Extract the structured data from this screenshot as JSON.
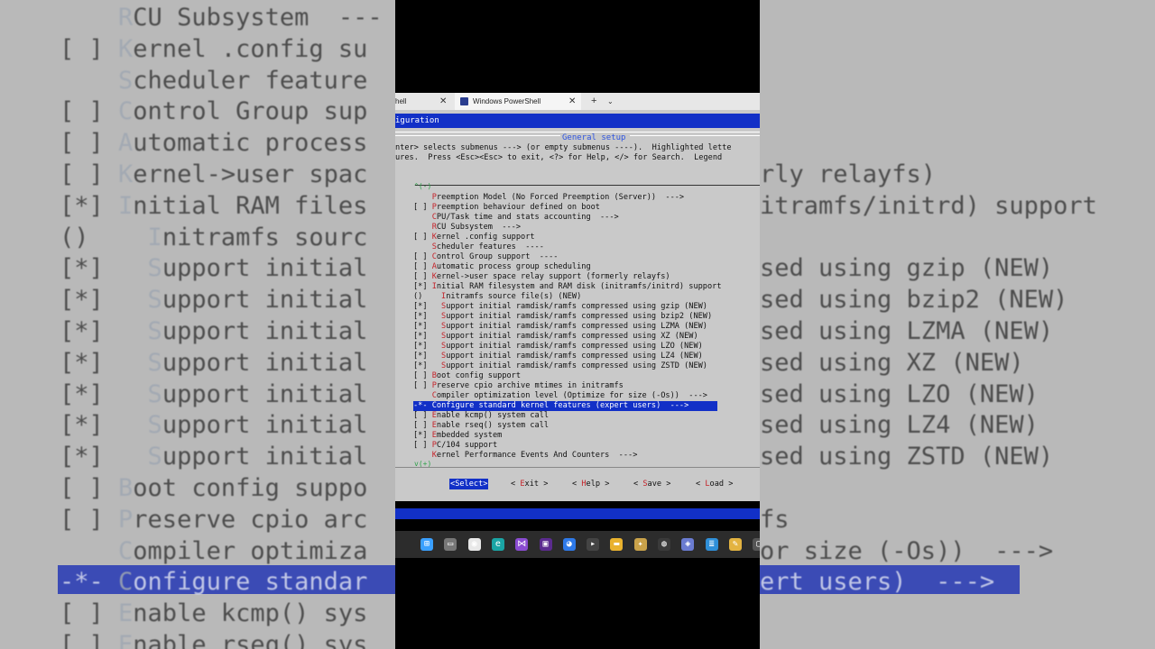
{
  "background": {
    "lines": [
      {
        "prefix": "    ",
        "hotkey": "R",
        "rest": "CU Subsystem  ---",
        "right": ""
      },
      {
        "prefix": "[ ] ",
        "hotkey": "K",
        "rest": "ernel .config su",
        "right": ""
      },
      {
        "prefix": "    ",
        "hotkey": "S",
        "rest": "cheduler feature",
        "right": ""
      },
      {
        "prefix": "[ ] ",
        "hotkey": "C",
        "rest": "ontrol Group sup",
        "right": ""
      },
      {
        "prefix": "[ ] ",
        "hotkey": "A",
        "rest": "utomatic process",
        "right": ""
      },
      {
        "prefix": "[ ] ",
        "hotkey": "K",
        "rest": "ernel->user spac",
        "right": "rly relayfs)"
      },
      {
        "prefix": "[*] ",
        "hotkey": "I",
        "rest": "nitial RAM files",
        "right": "itramfs/initrd) support"
      },
      {
        "prefix": "()    ",
        "hotkey": "I",
        "rest": "nitramfs sourc",
        "right": ""
      },
      {
        "prefix": "[*]   ",
        "hotkey": "S",
        "rest": "upport initial",
        "right": "sed using gzip (NEW)"
      },
      {
        "prefix": "[*]   ",
        "hotkey": "S",
        "rest": "upport initial",
        "right": "sed using bzip2 (NEW)"
      },
      {
        "prefix": "[*]   ",
        "hotkey": "S",
        "rest": "upport initial",
        "right": "sed using LZMA (NEW)"
      },
      {
        "prefix": "[*]   ",
        "hotkey": "S",
        "rest": "upport initial",
        "right": "sed using XZ (NEW)"
      },
      {
        "prefix": "[*]   ",
        "hotkey": "S",
        "rest": "upport initial",
        "right": "sed using LZO (NEW)"
      },
      {
        "prefix": "[*]   ",
        "hotkey": "S",
        "rest": "upport initial",
        "right": "sed using LZ4 (NEW)"
      },
      {
        "prefix": "[*]   ",
        "hotkey": "S",
        "rest": "upport initial",
        "right": "sed using ZSTD (NEW)"
      },
      {
        "prefix": "[ ] ",
        "hotkey": "B",
        "rest": "oot config suppo",
        "right": ""
      },
      {
        "prefix": "[ ] ",
        "hotkey": "P",
        "rest": "reserve cpio arc",
        "right": "fs"
      },
      {
        "prefix": "    ",
        "hotkey": "C",
        "rest": "ompiler optimiza",
        "right": "or size (-Os))  --->"
      },
      {
        "prefix": "-*- ",
        "hotkey": "C",
        "rest": "onfigure standar",
        "right": "ert users)  --->"
      },
      {
        "prefix": "[ ] ",
        "hotkey": "E",
        "rest": "nable kcmp() sys",
        "right": ""
      },
      {
        "prefix": "[ ] ",
        "hotkey": "E",
        "rest": "nable rseq() sys",
        "right": ""
      }
    ]
  },
  "tabs": {
    "tab1_label": "hell",
    "tab2_label": "Windows PowerShell",
    "close": "✕",
    "new_tab": "+",
    "dropdown": "⌄"
  },
  "terminal": {
    "title": "iguration",
    "panel_title": "General setup",
    "help_line1": "nter> selects submenus ---> (or empty submenus ----).  Highlighted lette",
    "help_line2": "ures.  Press <Esc><Esc> to exit, <?> for Help, </> for Search.  Legend",
    "scroll_up": "^(-)",
    "scroll_down": "v(+)",
    "menu": [
      {
        "prefix": "    ",
        "hotkey": "P",
        "rest": "reemption Model (No Forced Preemption (Server))  --->",
        "selected": false
      },
      {
        "prefix": "[ ] ",
        "hotkey": "P",
        "rest": "reemption behaviour defined on boot",
        "selected": false
      },
      {
        "prefix": "    ",
        "hotkey": "C",
        "rest": "PU/Task time and stats accounting  --->",
        "selected": false
      },
      {
        "prefix": "    ",
        "hotkey": "R",
        "rest": "CU Subsystem  --->",
        "selected": false
      },
      {
        "prefix": "[ ] ",
        "hotkey": "K",
        "rest": "ernel .config support",
        "selected": false
      },
      {
        "prefix": "    ",
        "hotkey": "S",
        "rest": "cheduler features  ----",
        "selected": false
      },
      {
        "prefix": "[ ] ",
        "hotkey": "C",
        "rest": "ontrol Group support  ----",
        "selected": false
      },
      {
        "prefix": "[ ] ",
        "hotkey": "A",
        "rest": "utomatic process group scheduling",
        "selected": false
      },
      {
        "prefix": "[ ] ",
        "hotkey": "K",
        "rest": "ernel->user space relay support (formerly relayfs)",
        "selected": false
      },
      {
        "prefix": "[*] ",
        "hotkey": "I",
        "rest": "nitial RAM filesystem and RAM disk (initramfs/initrd) support",
        "selected": false
      },
      {
        "prefix": "()    ",
        "hotkey": "I",
        "rest": "nitramfs source file(s) (NEW)",
        "selected": false
      },
      {
        "prefix": "[*]   ",
        "hotkey": "S",
        "rest": "upport initial ramdisk/ramfs compressed using gzip (NEW)",
        "selected": false
      },
      {
        "prefix": "[*]   ",
        "hotkey": "S",
        "rest": "upport initial ramdisk/ramfs compressed using bzip2 (NEW)",
        "selected": false
      },
      {
        "prefix": "[*]   ",
        "hotkey": "S",
        "rest": "upport initial ramdisk/ramfs compressed using LZMA (NEW)",
        "selected": false
      },
      {
        "prefix": "[*]   ",
        "hotkey": "S",
        "rest": "upport initial ramdisk/ramfs compressed using XZ (NEW)",
        "selected": false
      },
      {
        "prefix": "[*]   ",
        "hotkey": "S",
        "rest": "upport initial ramdisk/ramfs compressed using LZO (NEW)",
        "selected": false
      },
      {
        "prefix": "[*]   ",
        "hotkey": "S",
        "rest": "upport initial ramdisk/ramfs compressed using LZ4 (NEW)",
        "selected": false
      },
      {
        "prefix": "[*]   ",
        "hotkey": "S",
        "rest": "upport initial ramdisk/ramfs compressed using ZSTD (NEW)",
        "selected": false
      },
      {
        "prefix": "[ ] ",
        "hotkey": "B",
        "rest": "oot config support",
        "selected": false
      },
      {
        "prefix": "[ ] ",
        "hotkey": "P",
        "rest": "reserve cpio archive mtimes in initramfs",
        "selected": false
      },
      {
        "prefix": "    ",
        "hotkey": "C",
        "rest": "ompiler optimization level (Optimize for size (-Os))  --->",
        "selected": false
      },
      {
        "prefix": "-*- ",
        "hotkey": "C",
        "rest": "onfigure standard kernel features (expert users)  --->",
        "selected": true
      },
      {
        "prefix": "[ ] ",
        "hotkey": "E",
        "rest": "nable kcmp() system call",
        "selected": false
      },
      {
        "prefix": "[ ] ",
        "hotkey": "E",
        "rest": "nable rseq() system call",
        "selected": false
      },
      {
        "prefix": "[*] ",
        "hotkey": "E",
        "rest": "mbedded system",
        "selected": false
      },
      {
        "prefix": "[ ] ",
        "hotkey": "P",
        "rest": "C/104 support",
        "selected": false
      },
      {
        "prefix": "    ",
        "hotkey": "K",
        "rest": "ernel Performance Events And Counters  --->",
        "selected": false
      }
    ],
    "buttons": [
      {
        "before": "<",
        "hotkey": "S",
        "after": "elect>",
        "active": true
      },
      {
        "before": "< ",
        "hotkey": "E",
        "after": "xit >",
        "active": false
      },
      {
        "before": "< ",
        "hotkey": "H",
        "after": "elp >",
        "active": false
      },
      {
        "before": "< ",
        "hotkey": "S",
        "after": "ave >",
        "active": false
      },
      {
        "before": "< ",
        "hotkey": "L",
        "after": "oad >",
        "active": false
      }
    ]
  },
  "taskbar": {
    "icons": [
      {
        "name": "windows-start-icon",
        "color": "#3aa0ff",
        "glyph": "⊞"
      },
      {
        "name": "task-view-icon",
        "color": "#777777",
        "glyph": "▭"
      },
      {
        "name": "chrome-icon",
        "color": "#e8e8e8",
        "glyph": "◉"
      },
      {
        "name": "edge-icon",
        "color": "#1aa5a5",
        "glyph": "e"
      },
      {
        "name": "visual-studio-icon",
        "color": "#8a4cd1",
        "glyph": "⋈"
      },
      {
        "name": "ide-icon",
        "color": "#5b2b8f",
        "glyph": "▣"
      },
      {
        "name": "firefox-icon",
        "color": "#2e79e8",
        "glyph": "◕"
      },
      {
        "name": "terminal-icon",
        "color": "#444444",
        "glyph": "▸"
      },
      {
        "name": "file-explorer-icon",
        "color": "#e9b22e",
        "glyph": "▬"
      },
      {
        "name": "app-icon",
        "color": "#c9a24a",
        "glyph": "✦"
      },
      {
        "name": "settings-icon",
        "color": "#3a3a3a",
        "glyph": "◍"
      },
      {
        "name": "cube-icon",
        "color": "#6a7bd1",
        "glyph": "◈"
      },
      {
        "name": "notes-icon",
        "color": "#2f8fd8",
        "glyph": "≣"
      },
      {
        "name": "paint-icon",
        "color": "#e3b341",
        "glyph": "✎"
      },
      {
        "name": "window-icon",
        "color": "#555555",
        "glyph": "▢"
      }
    ]
  }
}
